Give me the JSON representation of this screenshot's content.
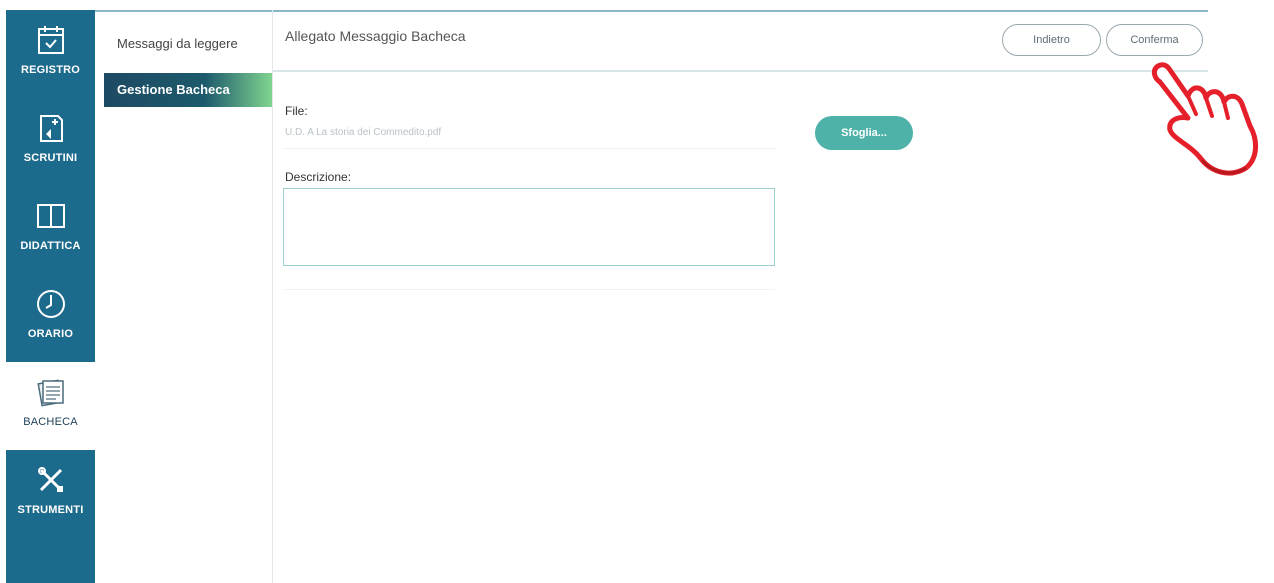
{
  "rail": [
    {
      "label": "REGISTRO",
      "icon": "calendar-check-icon"
    },
    {
      "label": "SCRUTINI",
      "icon": "document-add-icon"
    },
    {
      "label": "DIDATTICA",
      "icon": "book-icon"
    },
    {
      "label": "ORARIO",
      "icon": "clock-icon"
    },
    {
      "label": "BACHECA",
      "icon": "noticeboard-icon"
    },
    {
      "label": "STRUMENTI",
      "icon": "tools-icon"
    }
  ],
  "submenu": [
    {
      "label": "Messaggi da leggere"
    },
    {
      "label": "Gestione Bacheca"
    }
  ],
  "header": {
    "title": "Allegato Messaggio Bacheca",
    "back_label": "Indietro",
    "confirm_label": "Conferma"
  },
  "form": {
    "file_label": "File:",
    "file_value": "U.D. A La storia dei Commedito.pdf",
    "browse_label": "Sfoglia...",
    "description_label": "Descrizione:",
    "description_value": ""
  },
  "colors": {
    "rail_bg": "#1c6a8c",
    "accent": "#4eb2a9",
    "active_menu": "#1d4a63"
  }
}
